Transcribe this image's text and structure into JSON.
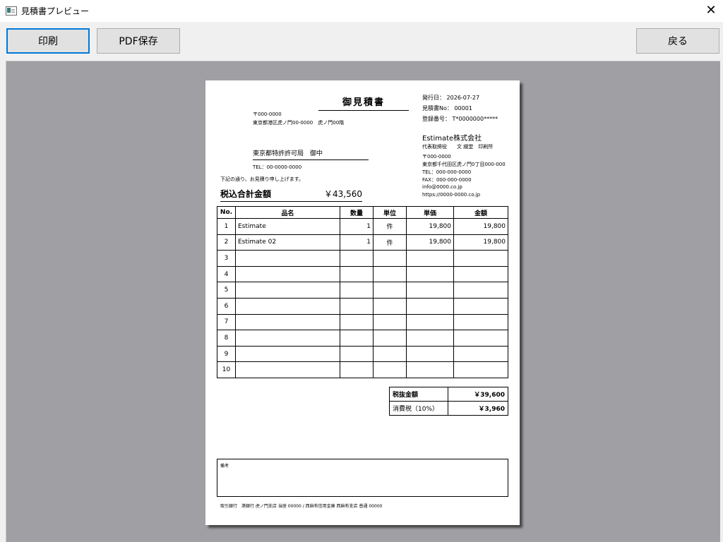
{
  "window": {
    "title": "見積書プレビュー",
    "close": "✕"
  },
  "toolbar": {
    "print": "印刷",
    "pdf": "PDF保存",
    "back": "戻る"
  },
  "doc": {
    "title": "御見積書",
    "issue": {
      "date_label": "発行日：",
      "date": "2026-07-27",
      "no_label": "見積書No：",
      "no": "00001",
      "reg_label": "登録番号：",
      "reg": "T*0000000*****"
    },
    "issuer": {
      "name": "Estimate株式会社",
      "rep": "代表取締役　　文 綴堂　印刷所",
      "zip": "〒000-0000",
      "address": "東京都千代田区虎ノ門0丁目000-000",
      "tel": "TEL：000-000-0000",
      "fax": "FAX：000-000-0000",
      "email": "info@0000.co.jp",
      "url": "https://0000-0000.co.jp"
    },
    "recipient": {
      "zip": "〒000-0000",
      "address": "東京都港区虎ノ門00-0000　虎ノ門00階",
      "name": "東京都特許許可局　御中",
      "tel": "TEL：00-0000-0000"
    },
    "greeting": "下記の通り、お見積り申し上げます。",
    "total_label": "税込合計金額",
    "total": "￥43,560",
    "columns": [
      "No.",
      "品名",
      "数量",
      "単位",
      "単価",
      "金額"
    ],
    "rows": [
      [
        "1",
        "Estimate",
        "1",
        "件",
        "19,800",
        "19,800"
      ],
      [
        "2",
        "Estimate 02",
        "1",
        "件",
        "19,800",
        "19,800"
      ],
      [
        "3",
        "",
        "",
        "",
        "",
        ""
      ],
      [
        "4",
        "",
        "",
        "",
        "",
        ""
      ],
      [
        "5",
        "",
        "",
        "",
        "",
        ""
      ],
      [
        "6",
        "",
        "",
        "",
        "",
        ""
      ],
      [
        "7",
        "",
        "",
        "",
        "",
        ""
      ],
      [
        "8",
        "",
        "",
        "",
        "",
        ""
      ],
      [
        "9",
        "",
        "",
        "",
        "",
        ""
      ],
      [
        "10",
        "",
        "",
        "",
        "",
        ""
      ]
    ],
    "subtotal_label": "税抜金額",
    "subtotal": "￥39,600",
    "tax_label": "消費税（10%）",
    "tax": "￥3,960",
    "notes_label": "備考",
    "bank": "取引銀行　港銀行 虎ノ門支店 当座 00000 / 西麻布信用金庫 西麻布支店 普通 00000"
  }
}
